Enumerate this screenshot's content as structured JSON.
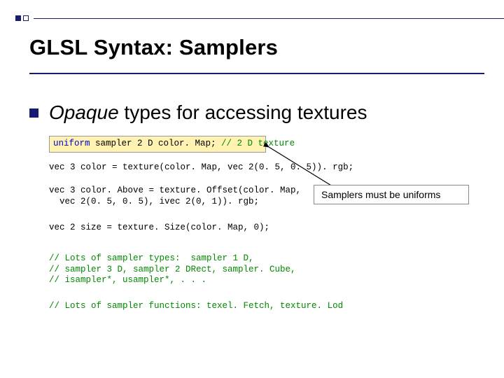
{
  "title": "GLSL Syntax:  Samplers",
  "bullet": {
    "italic_word": "Opaque",
    "rest": " types for accessing textures"
  },
  "code": {
    "uniform_kw": "uniform",
    "uniform_rest": " sampler 2 D color. Map; ",
    "uniform_comment": "// 2 D texture",
    "color_line": "vec 3 color = texture(color. Map, vec 2(0. 5, 0. 5)). rgb;",
    "above_line1": "vec 3 color. Above = texture. Offset(color. Map,",
    "above_line2": "  vec 2(0. 5, 0. 5), ivec 2(0, 1)). rgb;",
    "size_line": "vec 2 size = texture. Size(color. Map, 0);",
    "comment1": "// Lots of sampler types:  sampler 1 D,",
    "comment2": "// sampler 3 D, sampler 2 DRect, sampler. Cube,",
    "comment3": "// isampler*, usampler*, . . .",
    "func_comment": "// Lots of sampler functions: texel. Fetch, texture. Lod"
  },
  "callout": "Samplers must be uniforms"
}
